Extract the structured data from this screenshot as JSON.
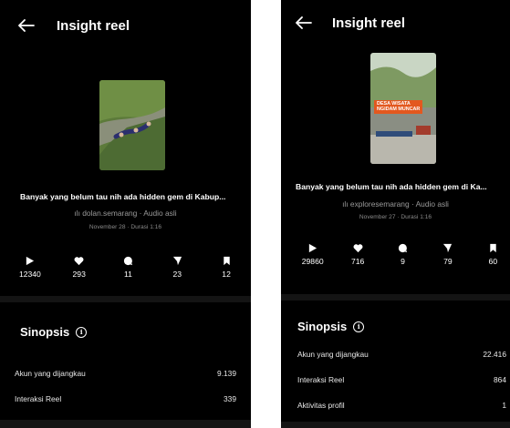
{
  "screens": [
    {
      "title": "Insight reel",
      "caption": "Banyak yang belum tau nih ada hidden gem di Kabup...",
      "account": "dolan.semarang · Audio asli",
      "date": "November 28 · Durasi 1:16",
      "stats": {
        "plays": "12340",
        "likes": "293",
        "comments": "11",
        "shares": "23",
        "saves": "12"
      },
      "section_title": "Sinopsis",
      "rows": [
        {
          "label": "Akun yang dijangkau",
          "value": "9.139"
        },
        {
          "label": "Interaksi Reel",
          "value": "339"
        }
      ]
    },
    {
      "title": "Insight reel",
      "thumb_text": {
        "line1": "DESA WISATA",
        "line2": "NGIDAM MUNCAR"
      },
      "caption": "Banyak yang belum tau nih ada hidden gem di Ka...",
      "account": "exploresemarang · Audio asli",
      "date": "November 27 · Durasi 1:16",
      "stats": {
        "plays": "29860",
        "likes": "716",
        "comments": "9",
        "shares": "79",
        "saves": "60"
      },
      "section_title": "Sinopsis",
      "rows": [
        {
          "label": "Akun yang dijangkau",
          "value": "22.416"
        },
        {
          "label": "Interaksi Reel",
          "value": "864"
        },
        {
          "label": "Aktivitas profil",
          "value": "1"
        }
      ]
    }
  ],
  "colors": {
    "background": "#000000",
    "muted_text": "#9a9a9a",
    "divider": "#141414"
  }
}
